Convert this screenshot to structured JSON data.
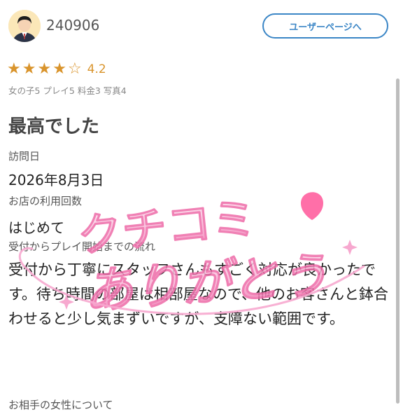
{
  "user": {
    "name": "240906",
    "profile_button": "ユーザーページへ"
  },
  "review": {
    "rating": 4.2,
    "rating_text": "4.2",
    "stars": {
      "filled": 4,
      "total": 5
    },
    "sub_scores": "女の子5 プレイ5 料金3 写真4",
    "title": "最高でした",
    "visit_label": "訪問日",
    "visit_date": "2026年8月3日",
    "usage_label": "お店の利用回数",
    "usage_value": "はじめて",
    "flow_label": "受付からプレイ開始までの流れ",
    "flow_text": "受付から丁寧にスタッフさんもすごく対応が良かったです。待ち時間の部屋は相部屋なので、他のお客さんと鉢合わせると少し気まずいですが、支障ない範囲です。",
    "next_label": "お相手の女性について"
  },
  "overlay": {
    "line1": "クチコミ",
    "line2": "ありがとう",
    "colors": {
      "pink": "#f7a8cf",
      "deep": "#ee6aa8",
      "heart": "#ff5f9e"
    }
  },
  "colors": {
    "accent": "#3b86c6",
    "star": "#d9942c"
  }
}
